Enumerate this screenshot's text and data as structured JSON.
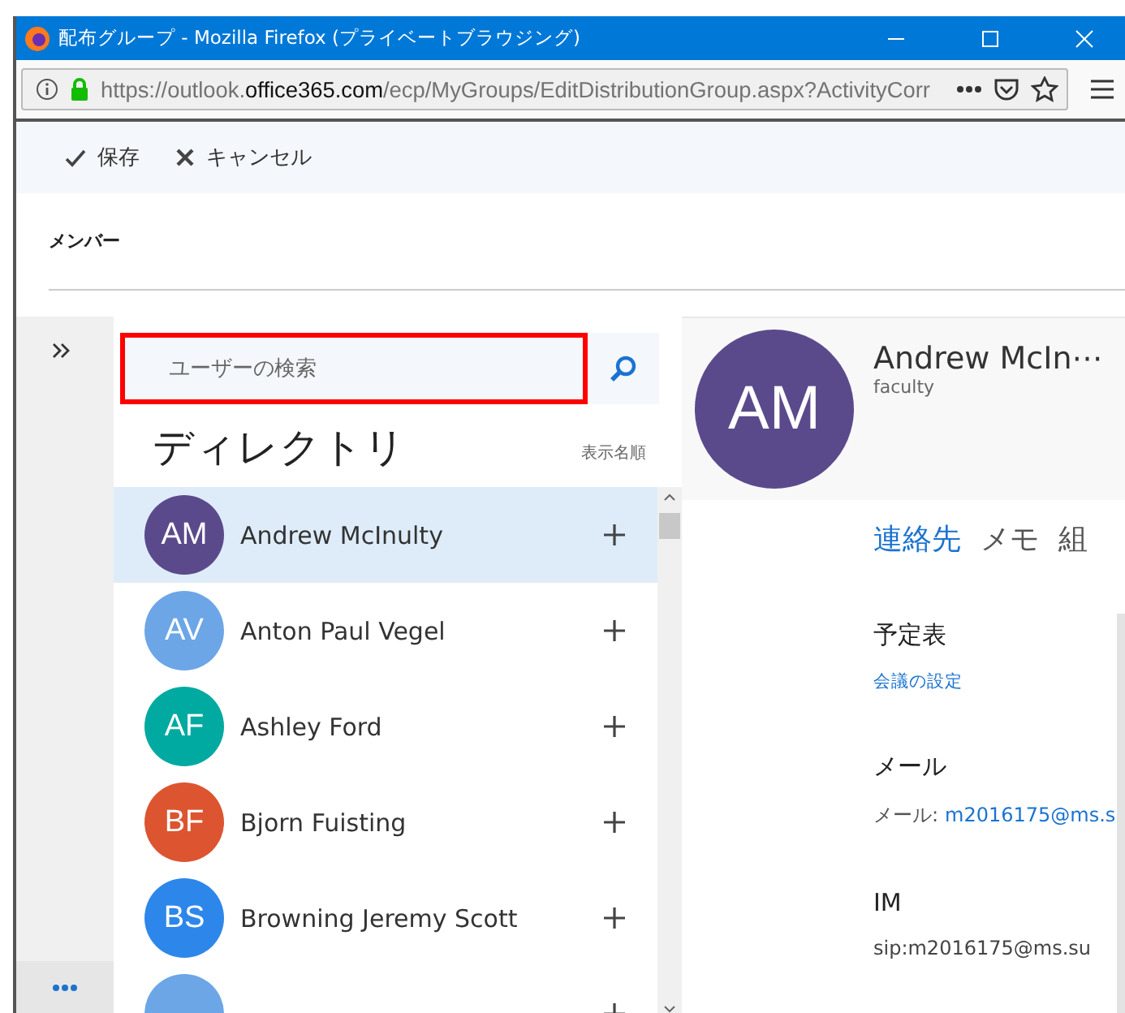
{
  "window": {
    "title": "配布グループ - Mozilla Firefox (プライベートブラウジング)"
  },
  "address_bar": {
    "url_prefix": "https://outlook.",
    "url_domain": "office365.com",
    "url_path": "/ecp/MyGroups/EditDistributionGroup.aspx?ActivityCorr"
  },
  "toolbar": {
    "buttons": [
      {
        "label": "保存",
        "kind": "save"
      },
      {
        "label": "キャンセル",
        "kind": "cancel"
      }
    ]
  },
  "section_title": "メンバー",
  "search": {
    "placeholder": "ユーザーの検索",
    "highlighted": true
  },
  "directory": {
    "title": "ディレクトリ",
    "sort": "表示名順",
    "people": [
      {
        "initials": "AM",
        "name": "Andrew McInulty",
        "color": "#5b4a8b",
        "selected": true
      },
      {
        "initials": "AV",
        "name": "Anton Paul Vegel",
        "color": "#6ca6e6",
        "selected": false
      },
      {
        "initials": "AF",
        "name": "Ashley Ford",
        "color": "#00aaa0",
        "selected": false
      },
      {
        "initials": "BF",
        "name": "Bjorn Fuisting",
        "color": "#dc5530",
        "selected": false
      },
      {
        "initials": "BS",
        "name": "Browning Jeremy Scott",
        "color": "#2d87ea",
        "selected": false
      },
      {
        "color": "#6ca6e6",
        "selected": false
      }
    ]
  },
  "detail": {
    "initials": "AM",
    "color": "#5b4a8b",
    "name": "Andrew McIn⋯",
    "subtitle": "faculty",
    "tabs": [
      {
        "label": "連絡先",
        "selected": true
      },
      {
        "label": "メモ",
        "selected": false
      },
      {
        "label": "組",
        "selected": false
      }
    ],
    "sections": [
      {
        "title": "予定表",
        "link": "会議の設定"
      },
      {
        "title": "メール",
        "label": "メール:",
        "link": "m2016175@ms.s"
      },
      {
        "title": "IM",
        "value": "sip:m2016175@ms.su"
      }
    ]
  }
}
